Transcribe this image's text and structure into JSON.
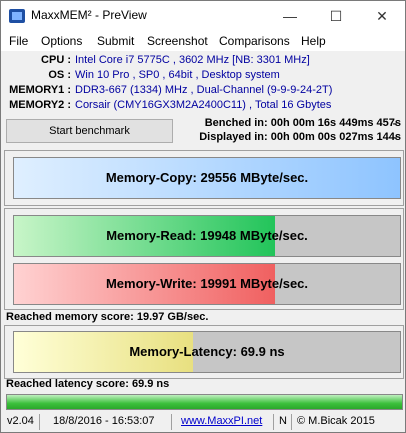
{
  "window": {
    "title": "MaxxMEM² - PreView",
    "minimize_glyph": "—",
    "maximize_glyph": "☐",
    "close_glyph": "✕"
  },
  "menu": [
    "File",
    "Options",
    "Submit",
    "Screenshot",
    "Comparisons",
    "Help"
  ],
  "system_info": [
    {
      "label": "CPU :",
      "value": "Intel Core i7 5775C , 3602 MHz [NB: 3301 MHz]"
    },
    {
      "label": "OS :",
      "value": "Win 10 Pro , SP0 , 64bit , Desktop system"
    },
    {
      "label": "MEMORY1 :",
      "value": "DDR3-667 (1334) MHz , Dual-Channel (9-9-9-24-2T)"
    },
    {
      "label": "MEMORY2 :",
      "value": "Corsair (CMY16GX3M2A2400C11) , Total 16 Gbytes"
    }
  ],
  "controls": {
    "start_label": "Start benchmark",
    "benched": "Benched in: 00h 00m 16s 449ms 457̵s",
    "displayed": "Displayed in: 00h 00m 00s 027ms 144̵s"
  },
  "benchmarks": {
    "copy": {
      "label": "Memory-Copy: 29556 MByte/sec.",
      "fill": 1.0,
      "color_start": "#dfefff",
      "color_end": "#8ec4ff"
    },
    "read": {
      "label": "Memory-Read: 19948 MByte/sec.",
      "fill": 0.675,
      "color_start": "#c8f5c8",
      "color_end": "#22c45a"
    },
    "write": {
      "label": "Memory-Write: 19991 MByte/sec.",
      "fill": 0.675,
      "color_start": "#ffd2d2",
      "color_end": "#f06060"
    },
    "latency": {
      "label": "Memory-Latency: 69.9 ns",
      "fill": 0.465,
      "color_start": "#ffffd8",
      "color_end": "#e8e080"
    }
  },
  "scores": {
    "memory": "Reached memory score: 19.97 GB/sec.",
    "latency": "Reached latency score: 69.9 ns"
  },
  "progress": {
    "fill": 1.0
  },
  "statusbar": {
    "version": "v2.04",
    "datetime": "18/8/2016 - 16:53:07",
    "link": "www.MaxxPI.net",
    "flag": "N",
    "author": "© M.Bicak 2015"
  }
}
